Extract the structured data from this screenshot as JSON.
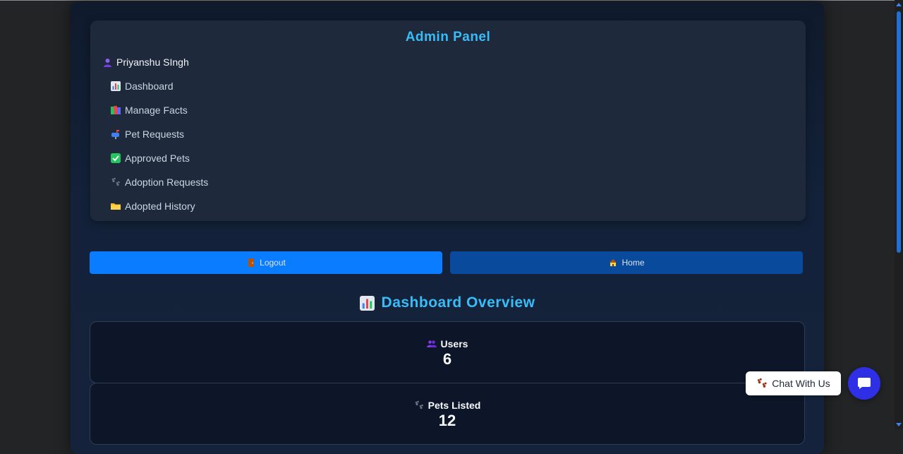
{
  "panel": {
    "title": "Admin Panel",
    "user_name": "Priyanshu SIngh",
    "nav": [
      {
        "label": "Dashboard",
        "icon": "bar-chart-icon"
      },
      {
        "label": "Manage Facts",
        "icon": "books-icon"
      },
      {
        "label": "Pet Requests",
        "icon": "mailbox-icon"
      },
      {
        "label": "Approved Pets",
        "icon": "check-mark-icon"
      },
      {
        "label": "Adoption Requests",
        "icon": "paw-prints-icon"
      },
      {
        "label": "Adopted History",
        "icon": "folder-icon"
      }
    ]
  },
  "actions": {
    "logout_label": "Logout",
    "home_label": "Home"
  },
  "overview": {
    "title": "Dashboard Overview",
    "stats": [
      {
        "label": "Users",
        "value": "6",
        "icon": "users-icon"
      },
      {
        "label": "Pets Listed",
        "value": "12",
        "icon": "paw-prints-icon"
      }
    ]
  },
  "chat": {
    "label": "Chat With Us"
  },
  "colors": {
    "accent": "#38bdf8",
    "logout_button": "#0a7cff",
    "home_button": "#0a4a9c",
    "chat_fab": "#2f2fe6",
    "panel_bg": "#1e293b"
  }
}
